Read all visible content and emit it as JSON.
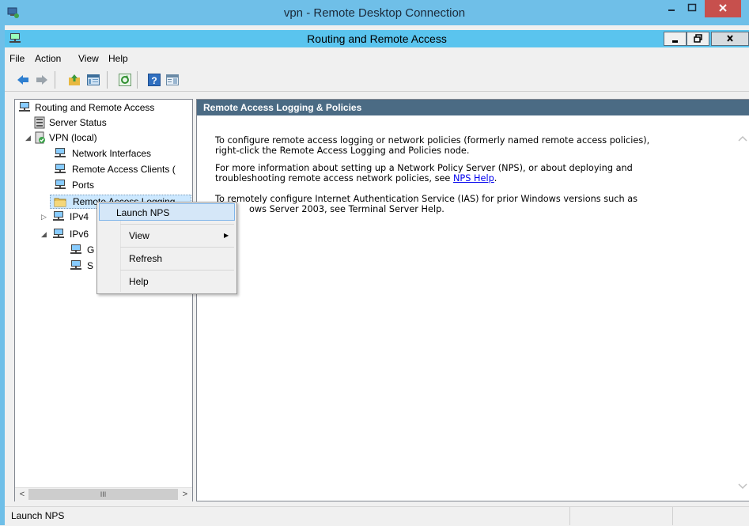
{
  "rdp": {
    "title": "vpn - Remote Desktop Connection",
    "minimize": "–",
    "maximize": "☐",
    "close": "✕"
  },
  "mmc": {
    "title": "Routing and Remote Access",
    "minimize": "▁",
    "restore": "❐",
    "close": "x"
  },
  "menu": {
    "file": "File",
    "action": "Action",
    "view": "View",
    "help": "Help"
  },
  "toolbar": {
    "icons": [
      "back-arrow-icon",
      "forward-arrow-icon",
      "up-folder-icon",
      "show-hide-tree-icon",
      "refresh-icon",
      "help-icon",
      "show-hide-action-pane-icon"
    ]
  },
  "tree": {
    "root": "Routing and Remote Access",
    "server_status": "Server Status",
    "vpn": "VPN (local)",
    "network_interfaces": "Network Interfaces",
    "remote_access_clients": "Remote Access Clients (",
    "ports": "Ports",
    "remote_access_logging": "Remote Access Logging",
    "ipv4": "IPv4",
    "ipv6": "IPv6",
    "ipv6_child1": "G",
    "ipv6_child2": "S"
  },
  "content": {
    "header": "Remote Access Logging & Policies",
    "p1_line1": "To configure remote access logging or network policies (formerly named remote access policies),",
    "p1_line2": "right-click the Remote Access Logging and Policies node.",
    "p2_line1": "For more information about setting up a Network Policy Server (NPS), or about deploying and",
    "p2_line2_prefix": "troubleshooting remote access network policies, see ",
    "p2_link": "NPS Help",
    "p2_line2_suffix": ".",
    "p3_line1": "To remotely configure Internet Authentication Service (IAS) for prior Windows versions such as",
    "p3_line2": "ows Server 2003, see Terminal Server Help."
  },
  "context_menu": {
    "launch_nps": "Launch NPS",
    "view": "View",
    "refresh": "Refresh",
    "help": "Help"
  },
  "scroll": {
    "left": "<",
    "thumb": "III",
    "right": ">"
  },
  "status": {
    "text": "Launch NPS"
  }
}
